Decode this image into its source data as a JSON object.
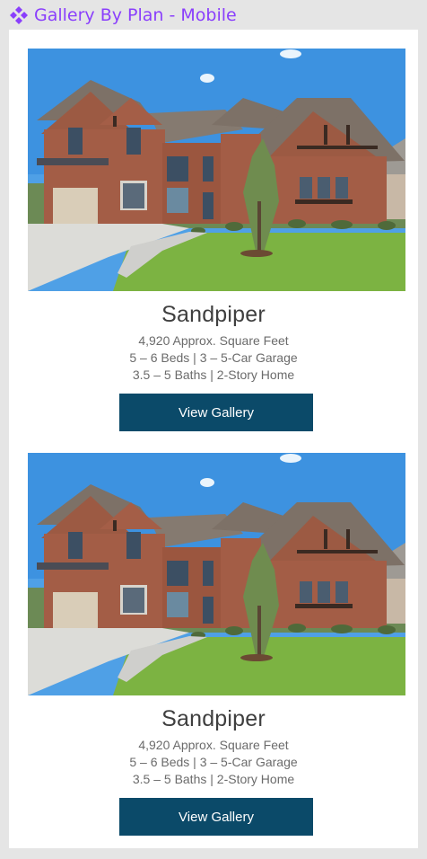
{
  "component": {
    "title": "Gallery By Plan - Mobile",
    "icon": "component-diamond-icon",
    "accent_color": "#8a3ffc"
  },
  "button_color": "#0b4a69",
  "plans": [
    {
      "name": "Sandpiper",
      "sqft": "4,920 Approx. Square Feet",
      "beds_garage": "5 – 6 Beds | 3 – 5-Car Garage",
      "baths_story": "3.5 – 5 Baths | 2-Story Home",
      "button_label": "View Gallery"
    },
    {
      "name": "Sandpiper",
      "sqft": "4,920 Approx. Square Feet",
      "beds_garage": "5 – 6 Beds | 3 – 5-Car Garage",
      "baths_story": "3.5 – 5 Baths | 2-Story Home",
      "button_label": "View Gallery"
    }
  ]
}
